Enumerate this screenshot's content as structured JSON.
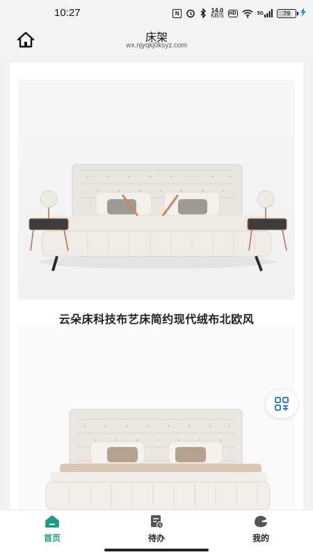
{
  "status_bar": {
    "time": "10:27",
    "nfc": "N",
    "network_speed_value": "14.0",
    "network_speed_unit": "KB/S",
    "hd": "HD",
    "signal_label": "5G",
    "battery_level": "79"
  },
  "header": {
    "title": "床架",
    "url": "wx.njyqkj0ksyz.com"
  },
  "product": {
    "title": "云朵床科技布艺床简约现代绒布北欧风"
  },
  "bottom_nav": {
    "home_label": "首页",
    "todo_label": "待办",
    "mine_label": "我的",
    "active": "home"
  },
  "colors": {
    "accent": "#1f9a85",
    "header_bg": "#f4f4f4",
    "float_icon": "#2f7fd4"
  }
}
